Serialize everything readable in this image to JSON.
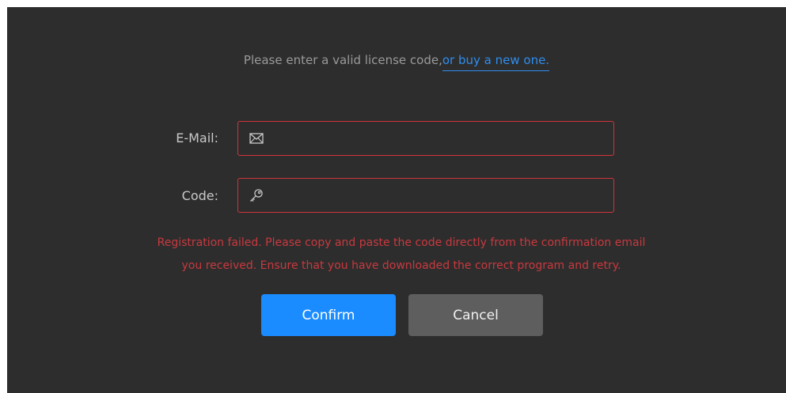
{
  "notice": {
    "text": "Please enter a valid license code,",
    "link_text": "or buy a new one."
  },
  "form": {
    "email": {
      "label": "E-Mail:",
      "value": "",
      "icon": "envelope-icon"
    },
    "code": {
      "label": "Code:",
      "value": "",
      "icon": "key-icon"
    }
  },
  "error": {
    "line1": "Registration failed. Please copy and paste the code directly from the confirmation email",
    "line2": "you received. Ensure that you have downloaded the correct program and retry."
  },
  "buttons": {
    "confirm_label": "Confirm",
    "cancel_label": "Cancel"
  },
  "colors": {
    "background": "#2d2d2d",
    "link": "#2e8ef0",
    "error": "#c8393f",
    "field_border": "#d0353c",
    "confirm": "#1a8cff",
    "cancel": "#5e5e5e"
  }
}
